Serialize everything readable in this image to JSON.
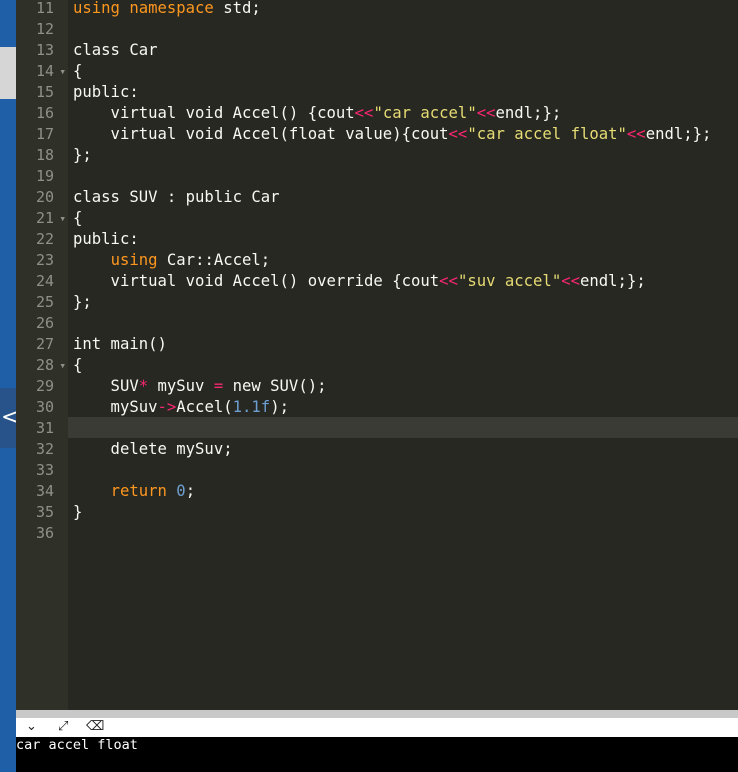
{
  "editor": {
    "line_numbers": [
      "11",
      "12",
      "13",
      "14",
      "15",
      "16",
      "17",
      "18",
      "19",
      "20",
      "21",
      "22",
      "23",
      "24",
      "25",
      "26",
      "27",
      "28",
      "29",
      "30",
      "31",
      "32",
      "33",
      "34",
      "35",
      "36"
    ],
    "fold_markers": {
      "14": "▾",
      "21": "▾",
      "28": "▾"
    }
  },
  "code": {
    "l11": [
      "using namespace",
      " std;"
    ],
    "l13": "class Car",
    "l14": "{",
    "l15": "public:",
    "l16": [
      "    virtual void Accel() {cout",
      "<<",
      "\"car accel\"",
      "<<",
      "endl;};"
    ],
    "l17": [
      "    virtual void Accel(float value){cout",
      "<<",
      "\"car accel float\"",
      "<<",
      "endl;};"
    ],
    "l18": "};",
    "l20": "class SUV : public Car",
    "l21": "{",
    "l22": "public:",
    "l23": [
      "    ",
      "using",
      " Car::Accel;"
    ],
    "l24": [
      "    virtual void Accel() override {cout",
      "<<",
      "\"suv accel\"",
      "<<",
      "endl;};"
    ],
    "l25": "};",
    "l27": "int main()",
    "l28": "{",
    "l29": [
      "    SUV",
      "*",
      " mySuv ",
      "=",
      " new SUV();"
    ],
    "l30": [
      "    mySuv",
      "->",
      "Accel(",
      "1.1f",
      ");"
    ],
    "l32": "    delete mySuv;",
    "l34": [
      "    ",
      "return",
      " ",
      "0",
      ";"
    ],
    "l35": "}"
  },
  "toolbar": {
    "collapse_icon": "chevron-down-icon",
    "expand_icon": "expand-arrows-icon",
    "clear_icon": "clear-console-icon"
  },
  "output": {
    "text": "car accel float"
  },
  "side": {
    "collapse_glyph": "<"
  }
}
